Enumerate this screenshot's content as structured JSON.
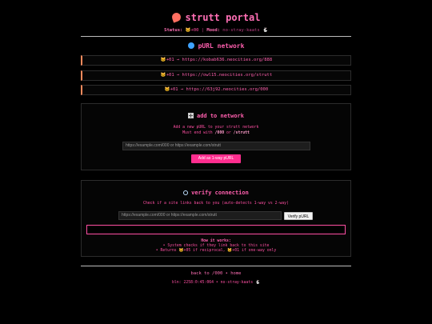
{
  "header": {
    "title": "strutt portal",
    "status_label": "Status:",
    "status_value": "🐱+00",
    "mood_label": "Mood:",
    "mood_value": "no-stray-kaats 🐇"
  },
  "network": {
    "title": "pURL network",
    "links": [
      "🐱+01 → https://kobab636.neocities.org/888",
      "🐱+01 → https://owl15.neocities.org/strutt",
      "🐱+01 → https://63j92.neocities.org/000"
    ]
  },
  "add": {
    "title": "add to network",
    "line1": "Add a new pURL to your strutt network",
    "line2_prefix": "Must end with ",
    "line2_a": "/000",
    "line2_mid": " or ",
    "line2_b": "/strutt",
    "input_placeholder": "https://example.com/000 or https://example.com/strutt",
    "button_label": "Add as 1-way pURL"
  },
  "verify": {
    "title": "verify connection",
    "subtitle": "Check if a site links back to you (auto-detects 1-way vs 2-way)",
    "input_placeholder": "https://example.com/000 or https://example.com/strutt",
    "button_label": "Verify pURL",
    "how_title": "How it works:",
    "how_line1": "• System checks if they link back to this site",
    "how_line2": "• Returns 🐱+05 if reciprocal, 🐱+01 if one-way only"
  },
  "footer": {
    "back_link": "back to /000 • home",
    "meta": "bln: 2258:0:45:064 • no-stray-kaats 🐇"
  },
  "colors": {
    "accent": "#ff4fa3",
    "button": "#ff2e8f",
    "background": "#000000"
  }
}
